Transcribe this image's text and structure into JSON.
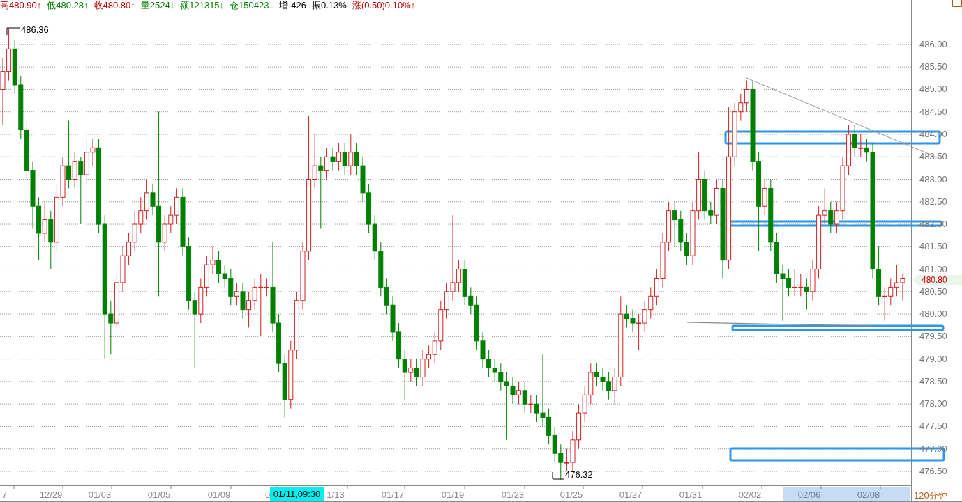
{
  "quote_bar": [
    {
      "text": "高480.90↑",
      "color": "#c00000"
    },
    {
      "text": "低480.28↑",
      "color": "#008000"
    },
    {
      "text": "收480.80↑",
      "color": "#c00000"
    },
    {
      "text": "量2524↓",
      "color": "#008000"
    },
    {
      "text": "额121315↓",
      "color": "#008000"
    },
    {
      "text": "仓150423↓",
      "color": "#008000"
    },
    {
      "text": "增-426",
      "color": "#000000"
    },
    {
      "text": "振0.13%",
      "color": "#000000"
    },
    {
      "text": "涨(0.50)0.10%↑",
      "color": "#c00000"
    }
  ],
  "chart": {
    "high_label": "486.36",
    "low_label": "476.32",
    "last_price": "480.80",
    "chart_data": {
      "type": "candlestick",
      "ylim": [
        476.19,
        486.99
      ],
      "grid": true,
      "yticks": [
        {
          "value": 486,
          "label": "486.00"
        },
        {
          "value": 485.5,
          "label": "485.50"
        },
        {
          "value": 485,
          "label": "485.00"
        },
        {
          "value": 484.5,
          "label": "484.50"
        },
        {
          "value": 484,
          "label": "484.00"
        },
        {
          "value": 483.5,
          "label": "483.50"
        },
        {
          "value": 483,
          "label": "483.00"
        },
        {
          "value": 482.5,
          "label": "482.50"
        },
        {
          "value": 482,
          "label": "482.00"
        },
        {
          "value": 481.5,
          "label": "481.50"
        },
        {
          "value": 481,
          "label": "481.00"
        },
        {
          "value": 480.5,
          "label": "480.50"
        },
        {
          "value": 480,
          "label": "480.00"
        },
        {
          "value": 479.5,
          "label": "479.50"
        },
        {
          "value": 479,
          "label": "479.00"
        },
        {
          "value": 478.5,
          "label": "478.50"
        },
        {
          "value": 478,
          "label": "478.00"
        },
        {
          "value": 477.5,
          "label": "477.50"
        },
        {
          "value": 477,
          "label": "477.00"
        },
        {
          "value": 476.5,
          "label": "476.50"
        }
      ],
      "ohlc": [
        [
          485.0,
          485.7,
          484.2,
          485.4
        ],
        [
          485.4,
          486.36,
          485.2,
          485.9
        ],
        [
          485.9,
          486.1,
          484.9,
          485.1
        ],
        [
          485.1,
          485.3,
          483.9,
          484.1
        ],
        [
          484.1,
          484.3,
          483.0,
          483.2
        ],
        [
          483.2,
          483.4,
          481.9,
          482.4
        ],
        [
          482.4,
          482.6,
          481.2,
          481.8
        ],
        [
          481.8,
          482.5,
          481.6,
          482.1
        ],
        [
          482.1,
          482.3,
          481.0,
          481.6
        ],
        [
          481.6,
          482.9,
          481.4,
          482.6
        ],
        [
          482.6,
          483.5,
          482.4,
          483.3
        ],
        [
          483.3,
          484.3,
          482.8,
          483.0
        ],
        [
          483.0,
          483.6,
          482.8,
          483.4
        ],
        [
          483.4,
          483.5,
          482.0,
          483.1
        ],
        [
          483.1,
          483.9,
          482.9,
          483.6
        ],
        [
          483.6,
          483.9,
          483.3,
          483.7
        ],
        [
          483.7,
          483.9,
          481.8,
          482.0
        ],
        [
          482.0,
          482.2,
          479.0,
          480.0
        ],
        [
          480.0,
          480.3,
          479.1,
          479.8
        ],
        [
          479.8,
          480.9,
          479.6,
          480.7
        ],
        [
          480.7,
          481.5,
          480.5,
          481.3
        ],
        [
          481.3,
          481.8,
          481.1,
          481.6
        ],
        [
          481.6,
          482.3,
          481.4,
          482.0
        ],
        [
          482.0,
          482.6,
          481.8,
          482.3
        ],
        [
          482.3,
          483.0,
          482.1,
          482.7
        ],
        [
          482.7,
          482.9,
          482.2,
          482.4
        ],
        [
          482.4,
          484.5,
          480.4,
          481.6
        ],
        [
          481.6,
          482.2,
          481.4,
          482.0
        ],
        [
          482.0,
          482.4,
          481.8,
          482.2
        ],
        [
          482.2,
          482.8,
          482.0,
          482.6
        ],
        [
          482.6,
          482.8,
          481.3,
          481.5
        ],
        [
          481.5,
          481.7,
          480.1,
          480.3
        ],
        [
          480.3,
          480.5,
          478.8,
          480.0
        ],
        [
          480.0,
          480.8,
          479.8,
          480.6
        ],
        [
          480.6,
          481.3,
          480.4,
          481.1
        ],
        [
          481.1,
          481.5,
          480.9,
          481.2
        ],
        [
          481.2,
          481.4,
          480.7,
          480.9
        ],
        [
          480.9,
          481.1,
          480.6,
          480.8
        ],
        [
          480.8,
          481.0,
          480.2,
          480.4
        ],
        [
          480.4,
          480.7,
          480.2,
          480.5
        ],
        [
          480.5,
          480.7,
          479.9,
          480.1
        ],
        [
          480.1,
          480.5,
          479.7,
          480.3
        ],
        [
          480.3,
          480.8,
          480.1,
          480.6
        ],
        [
          480.6,
          480.9,
          479.5,
          480.6
        ],
        [
          480.6,
          480.8,
          480.4,
          480.6
        ],
        [
          480.6,
          481.6,
          479.6,
          479.8
        ],
        [
          479.8,
          480.0,
          478.7,
          478.9
        ],
        [
          478.9,
          479.1,
          477.7,
          478.1
        ],
        [
          478.1,
          479.4,
          477.9,
          479.2
        ],
        [
          479.2,
          480.5,
          479.0,
          480.3
        ],
        [
          480.3,
          481.6,
          480.1,
          481.4
        ],
        [
          481.4,
          484.4,
          481.2,
          483.0
        ],
        [
          483.0,
          484.0,
          482.8,
          483.3
        ],
        [
          483.3,
          483.5,
          481.9,
          483.2
        ],
        [
          483.2,
          483.7,
          483.0,
          483.5
        ],
        [
          483.5,
          483.7,
          483.2,
          483.4
        ],
        [
          483.4,
          483.8,
          483.2,
          483.6
        ],
        [
          483.6,
          483.8,
          483.1,
          483.3
        ],
        [
          483.3,
          484.0,
          483.1,
          483.6
        ],
        [
          483.6,
          483.8,
          483.1,
          483.3
        ],
        [
          483.3,
          483.5,
          482.5,
          482.7
        ],
        [
          482.7,
          482.9,
          481.8,
          482.0
        ],
        [
          482.0,
          482.2,
          481.2,
          481.4
        ],
        [
          481.4,
          481.6,
          480.4,
          480.6
        ],
        [
          480.6,
          480.8,
          480.0,
          480.2
        ],
        [
          480.2,
          480.4,
          479.4,
          479.6
        ],
        [
          479.6,
          479.8,
          478.8,
          479.0
        ],
        [
          479.0,
          479.2,
          478.1,
          478.7
        ],
        [
          478.7,
          479.0,
          478.5,
          478.8
        ],
        [
          478.8,
          479.0,
          478.4,
          478.6
        ],
        [
          478.6,
          479.2,
          478.4,
          479.0
        ],
        [
          479.0,
          479.3,
          478.8,
          479.1
        ],
        [
          479.1,
          479.6,
          478.9,
          479.4
        ],
        [
          479.4,
          480.3,
          479.2,
          480.1
        ],
        [
          480.1,
          480.7,
          479.9,
          480.5
        ],
        [
          480.5,
          482.2,
          480.3,
          480.7
        ],
        [
          480.7,
          481.2,
          480.5,
          481.0
        ],
        [
          481.0,
          481.2,
          480.2,
          480.4
        ],
        [
          480.4,
          480.6,
          480.0,
          480.2
        ],
        [
          480.2,
          480.4,
          479.2,
          479.4
        ],
        [
          479.4,
          479.6,
          478.8,
          479.0
        ],
        [
          479.0,
          479.2,
          478.6,
          478.8
        ],
        [
          478.8,
          479.0,
          478.5,
          478.7
        ],
        [
          478.7,
          478.9,
          478.3,
          478.5
        ],
        [
          478.5,
          478.7,
          477.2,
          478.4
        ],
        [
          478.4,
          478.6,
          478.0,
          478.2
        ],
        [
          478.2,
          478.5,
          478.0,
          478.3
        ],
        [
          478.3,
          478.5,
          477.8,
          478.0
        ],
        [
          478.0,
          478.2,
          477.8,
          478.0
        ],
        [
          478.0,
          478.2,
          477.6,
          477.8
        ],
        [
          477.8,
          479.1,
          477.5,
          477.7
        ],
        [
          477.7,
          477.9,
          477.1,
          477.3
        ],
        [
          477.3,
          477.5,
          476.7,
          476.9
        ],
        [
          476.9,
          477.1,
          476.32,
          476.7
        ],
        [
          476.7,
          477.0,
          476.5,
          476.7
        ],
        [
          476.7,
          477.4,
          476.5,
          477.2
        ],
        [
          477.2,
          478.0,
          477.0,
          477.8
        ],
        [
          477.8,
          478.4,
          477.6,
          478.2
        ],
        [
          478.2,
          478.9,
          478.0,
          478.7
        ],
        [
          478.7,
          478.9,
          478.4,
          478.6
        ],
        [
          478.6,
          478.8,
          478.3,
          478.5
        ],
        [
          478.5,
          478.7,
          478.1,
          478.3
        ],
        [
          478.3,
          478.8,
          478.0,
          478.6
        ],
        [
          478.6,
          480.4,
          478.4,
          480.0
        ],
        [
          480.0,
          480.2,
          479.7,
          479.9
        ],
        [
          479.9,
          480.1,
          479.6,
          479.8
        ],
        [
          479.8,
          480.0,
          479.2,
          479.8
        ],
        [
          479.8,
          480.3,
          479.6,
          480.1
        ],
        [
          480.1,
          480.6,
          479.9,
          480.4
        ],
        [
          480.4,
          481.0,
          480.2,
          480.8
        ],
        [
          480.8,
          481.8,
          480.6,
          481.6
        ],
        [
          481.6,
          482.5,
          481.4,
          482.3
        ],
        [
          482.3,
          482.5,
          481.5,
          482.1
        ],
        [
          482.1,
          482.3,
          481.4,
          481.6
        ],
        [
          481.6,
          481.8,
          481.1,
          481.3
        ],
        [
          481.3,
          482.5,
          481.1,
          482.3
        ],
        [
          482.3,
          483.6,
          482.1,
          483.0
        ],
        [
          483.0,
          483.2,
          482.1,
          482.3
        ],
        [
          482.3,
          482.5,
          482.0,
          482.2
        ],
        [
          482.2,
          483.0,
          482.0,
          482.8
        ],
        [
          482.8,
          483.0,
          480.8,
          481.2
        ],
        [
          481.2,
          484.6,
          481.0,
          483.5
        ],
        [
          483.5,
          484.7,
          483.3,
          484.5
        ],
        [
          484.5,
          484.9,
          484.3,
          484.7
        ],
        [
          484.7,
          485.2,
          484.5,
          485.0
        ],
        [
          485.0,
          485.2,
          483.2,
          483.4
        ],
        [
          483.4,
          483.6,
          481.4,
          482.4
        ],
        [
          482.4,
          483.0,
          482.2,
          482.8
        ],
        [
          482.8,
          483.0,
          481.4,
          481.6
        ],
        [
          481.6,
          481.8,
          480.7,
          480.9
        ],
        [
          480.9,
          481.1,
          479.85,
          480.8
        ],
        [
          480.8,
          481.0,
          480.4,
          480.6
        ],
        [
          480.6,
          481.0,
          480.4,
          480.6
        ],
        [
          480.6,
          480.9,
          480.4,
          480.6
        ],
        [
          480.6,
          480.8,
          480.1,
          480.5
        ],
        [
          480.5,
          481.2,
          480.3,
          481.0
        ],
        [
          481.0,
          482.4,
          480.8,
          482.2
        ],
        [
          482.2,
          482.8,
          482.0,
          482.3
        ],
        [
          482.3,
          482.5,
          481.8,
          482.0
        ],
        [
          482.0,
          482.5,
          481.8,
          482.3
        ],
        [
          482.3,
          483.5,
          482.1,
          483.3
        ],
        [
          483.3,
          484.2,
          483.1,
          484.0
        ],
        [
          484.0,
          484.2,
          483.5,
          483.7
        ],
        [
          483.7,
          484.0,
          483.5,
          483.7
        ],
        [
          483.7,
          483.9,
          483.4,
          483.6
        ],
        [
          483.6,
          483.8,
          480.8,
          481.0
        ],
        [
          481.0,
          481.5,
          480.2,
          480.4
        ],
        [
          480.4,
          480.6,
          479.85,
          480.4
        ],
        [
          480.4,
          480.8,
          480.2,
          480.6
        ],
        [
          480.6,
          481.1,
          480.4,
          480.7
        ],
        [
          480.7,
          480.9,
          480.3,
          480.8
        ]
      ]
    },
    "time_axis": [
      {
        "text": "7",
        "selected": false
      },
      {
        "text": "12/29",
        "selected": false
      },
      {
        "text": "01/03",
        "selected": false
      },
      {
        "text": "01/05",
        "selected": false
      },
      {
        "text": "01/09",
        "selected": false
      },
      {
        "text": "0",
        "selected": false
      },
      {
        "text": "1/13",
        "selected": false
      },
      {
        "text": "01/17",
        "selected": false
      },
      {
        "text": "01/19",
        "selected": false
      },
      {
        "text": "01/23",
        "selected": false
      },
      {
        "text": "01/25",
        "selected": false
      },
      {
        "text": "01/27",
        "selected": false
      },
      {
        "text": "01/31",
        "selected": false
      },
      {
        "text": "02/02",
        "selected": false
      },
      {
        "text": "02/06",
        "selected": true
      },
      {
        "text": "02/08",
        "selected": true
      }
    ],
    "cursor_time": "01/11,09:30",
    "period": "120分钟"
  }
}
